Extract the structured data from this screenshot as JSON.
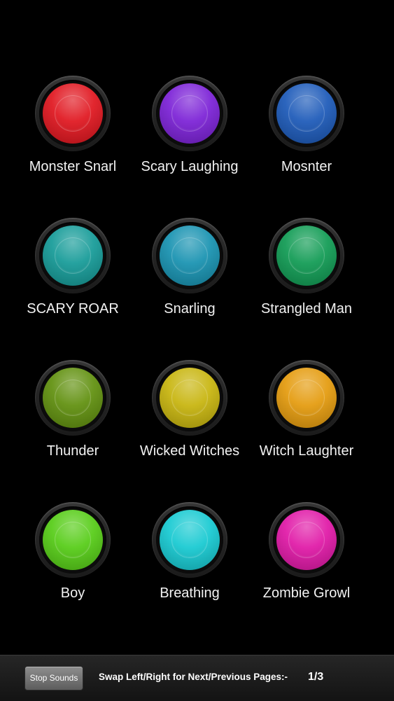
{
  "sound_buttons": [
    {
      "label": "Monster Snarl",
      "color": "#e0141d"
    },
    {
      "label": "Scary Laughing",
      "color": "#7a1fd6"
    },
    {
      "label": "Mosnter",
      "color": "#1a58b8"
    },
    {
      "label": "SCARY ROAR",
      "color": "#139a97"
    },
    {
      "label": "Snarling",
      "color": "#1591b0"
    },
    {
      "label": "Strangled Man",
      "color": "#0e9a52"
    },
    {
      "label": "Thunder",
      "color": "#5f8f0c"
    },
    {
      "label": "Wicked Witches",
      "color": "#c7b40b"
    },
    {
      "label": "Witch Laughter",
      "color": "#e49a0b"
    },
    {
      "label": "Boy",
      "color": "#54cc14"
    },
    {
      "label": "Breathing",
      "color": "#14c9d1"
    },
    {
      "label": "Zombie Growl",
      "color": "#e016a6"
    }
  ],
  "bottom_bar": {
    "stop_label": "Stop Sounds",
    "swap_text": "Swap Left/Right for Next/Previous Pages:-",
    "page_indicator": "1/3"
  }
}
